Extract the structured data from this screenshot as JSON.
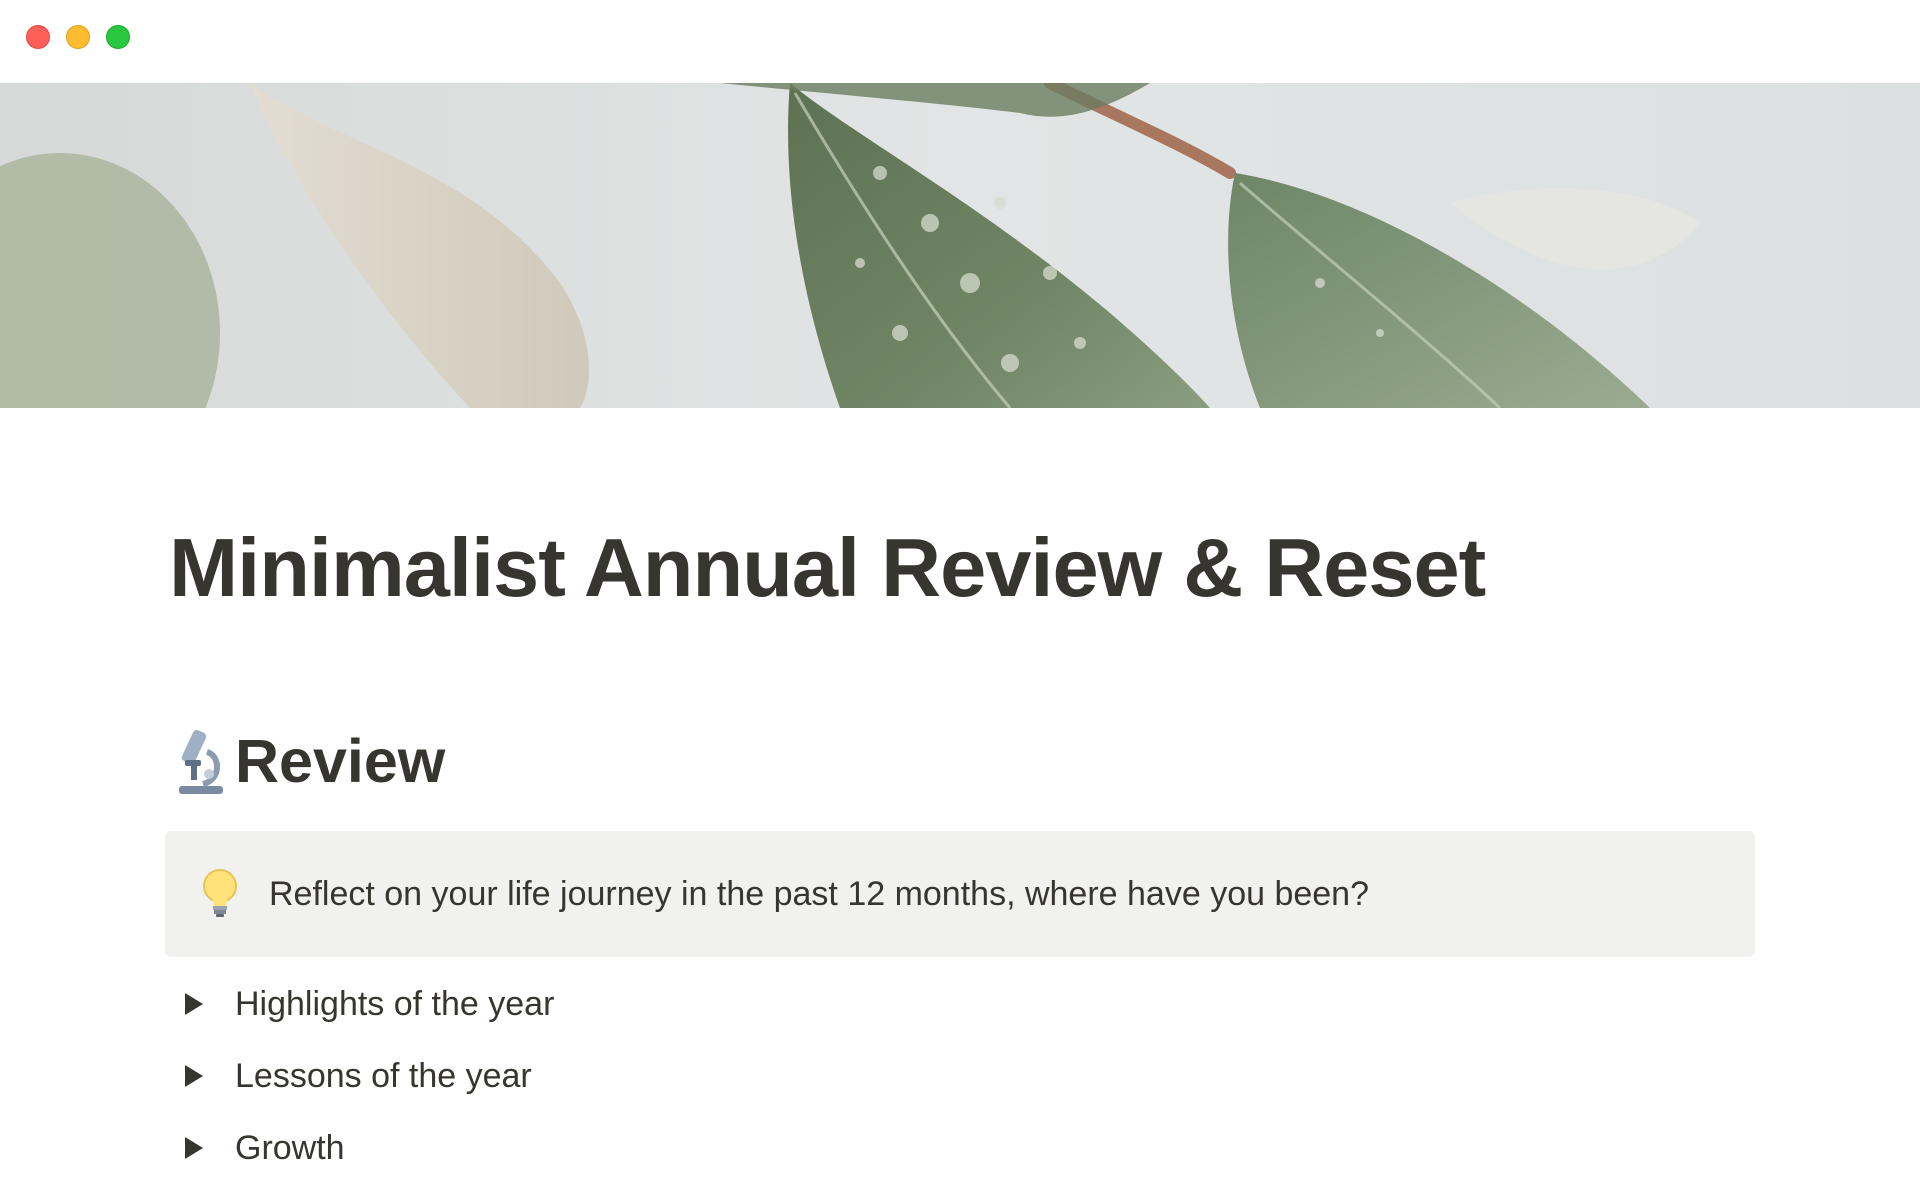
{
  "window": {
    "controls": [
      "close",
      "minimize",
      "zoom"
    ],
    "control_colors": {
      "close": "#fe5f57",
      "minimize": "#febc2e",
      "zoom": "#28c840"
    }
  },
  "cover": {
    "icon": "leaf-cover-image"
  },
  "page": {
    "title": "Minimalist Annual Review & Reset",
    "section": {
      "icon": "microscope-icon",
      "heading": "Review"
    },
    "callout": {
      "icon": "light-bulb-icon",
      "text": "Reflect on your life journey in the past 12 months, where have you been?",
      "background": "#f1f1ef"
    },
    "toggles": [
      {
        "label": "Highlights of the year"
      },
      {
        "label": "Lessons of the year"
      },
      {
        "label": "Growth"
      }
    ]
  }
}
